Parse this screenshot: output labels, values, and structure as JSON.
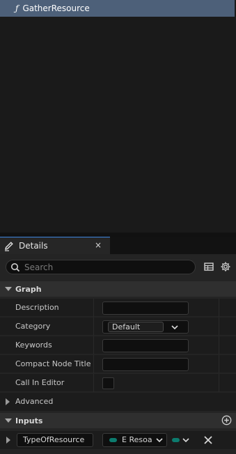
{
  "functions": {
    "selected_item": {
      "icon": "function-icon",
      "glyph": "ƒ",
      "label": "GatherResource"
    }
  },
  "details_tab": {
    "title": "Details",
    "close_glyph": "×",
    "icon": "pencil-icon"
  },
  "search": {
    "placeholder": "Search",
    "value": ""
  },
  "toolbar": {
    "table_icon": "table-view-icon",
    "settings_icon": "gear-icon"
  },
  "sections": {
    "graph": "Graph",
    "advanced": "Advanced",
    "inputs": "Inputs"
  },
  "graph_props": {
    "description": {
      "label": "Description",
      "value": ""
    },
    "category": {
      "label": "Category",
      "value": "Default"
    },
    "keywords": {
      "label": "Keywords",
      "value": ""
    },
    "compact_node_title": {
      "label": "Compact Node Title",
      "value": ""
    },
    "call_in_editor": {
      "label": "Call In Editor",
      "checked": false
    }
  },
  "inputs": [
    {
      "name": "TypeOfResource",
      "type": "E Resoa",
      "pin_color": "#0c7b6e"
    }
  ],
  "colors": {
    "selection": "#4d6079",
    "tab_accent": "#3d86e0",
    "pin": "#0c7b6e"
  }
}
